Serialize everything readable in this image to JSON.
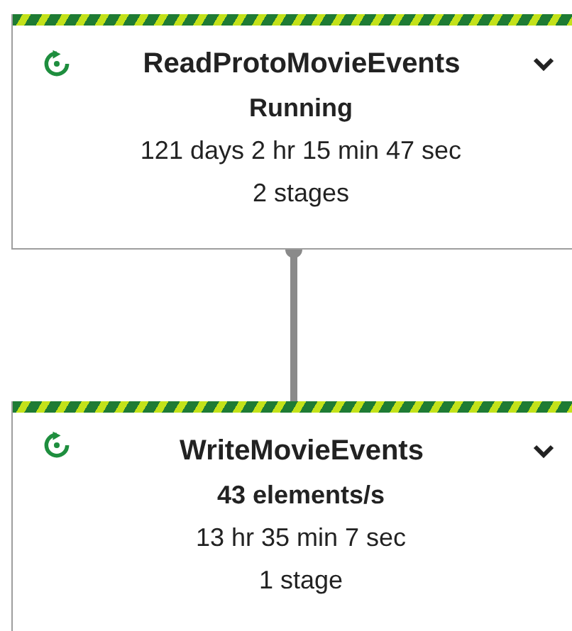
{
  "stages": [
    {
      "name": "ReadProtoMovieEvents",
      "kind": "running",
      "headline": "Running",
      "duration": "121 days 2 hr 15 min 47 sec",
      "stage_count": "2 stages",
      "expanded": false
    },
    {
      "name": "WriteMovieEvents",
      "kind": "running",
      "headline": "43 elements/s",
      "duration": "13 hr 35 min 7 sec",
      "stage_count": "1 stage",
      "expanded": false
    }
  ]
}
